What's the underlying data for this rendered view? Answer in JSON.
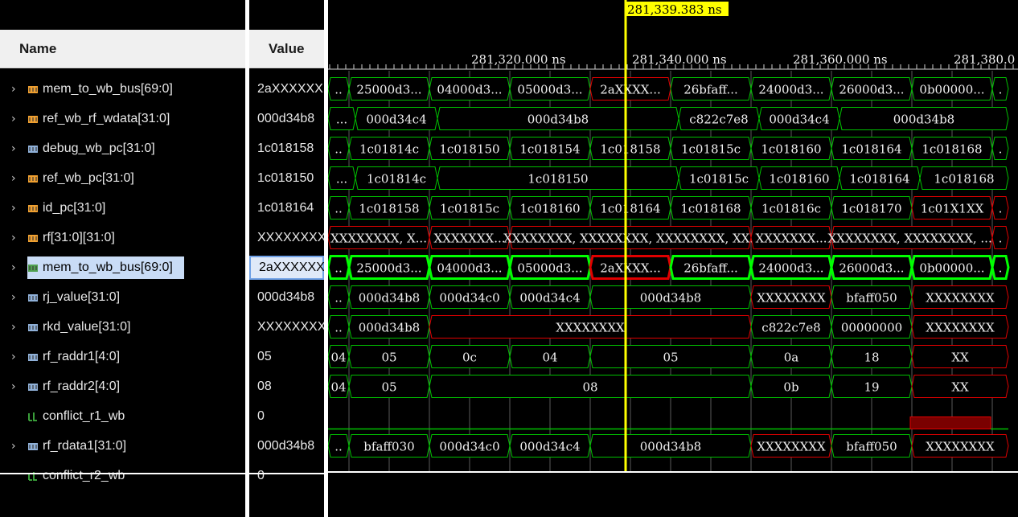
{
  "columns": {
    "name": "Name",
    "value": "Value"
  },
  "cursor": {
    "time_label": "281,339.383 ns",
    "color": "#ffff00"
  },
  "timeline": {
    "labels": [
      "281,320.000 ns",
      "281,340.000 ns",
      "281,360.000 ns",
      "281,380.0"
    ]
  },
  "colors": {
    "green": "#00c000",
    "red": "#e00000",
    "highlight_green": "#00ff00",
    "grid": "#5a5a5a",
    "selection": "#c9dcf6"
  },
  "signals": [
    {
      "name": "mem_to_wb_bus[69:0]",
      "value": "2aXXXXXX",
      "expandable": true,
      "icon": "bus-icon-orange",
      "selected": false,
      "segments": [
        {
          "text": "..",
          "state": "ok"
        },
        {
          "text": "25000d3...",
          "state": "ok"
        },
        {
          "text": "04000d3...",
          "state": "ok"
        },
        {
          "text": "05000d3...",
          "state": "ok"
        },
        {
          "text": "2aXXXX...",
          "state": "x"
        },
        {
          "text": "26bfaff...",
          "state": "ok"
        },
        {
          "text": "24000d3...",
          "state": "ok"
        },
        {
          "text": "26000d3...",
          "state": "ok"
        },
        {
          "text": "0b00000...",
          "state": "ok"
        },
        {
          "text": ".",
          "state": "ok"
        }
      ]
    },
    {
      "name": "ref_wb_rf_wdata[31:0]",
      "value": "000d34b8",
      "expandable": true,
      "icon": "bus-icon-orange",
      "selected": false,
      "segments": [
        {
          "text": "...",
          "state": "ok"
        },
        {
          "text": "000d34c4",
          "state": "ok"
        },
        {
          "text": "000d34b8",
          "state": "ok"
        },
        {
          "text": "c822c7e8",
          "state": "ok"
        },
        {
          "text": "000d34c4",
          "state": "ok"
        },
        {
          "text": "000d34b8",
          "state": "ok"
        }
      ]
    },
    {
      "name": "debug_wb_pc[31:0]",
      "value": "1c018158",
      "expandable": true,
      "icon": "bus-icon-blue",
      "selected": false,
      "segments": [
        {
          "text": "..",
          "state": "ok"
        },
        {
          "text": "1c01814c",
          "state": "ok"
        },
        {
          "text": "1c018150",
          "state": "ok"
        },
        {
          "text": "1c018154",
          "state": "ok"
        },
        {
          "text": "1c018158",
          "state": "ok"
        },
        {
          "text": "1c01815c",
          "state": "ok"
        },
        {
          "text": "1c018160",
          "state": "ok"
        },
        {
          "text": "1c018164",
          "state": "ok"
        },
        {
          "text": "1c018168",
          "state": "ok"
        },
        {
          "text": ".",
          "state": "ok"
        }
      ]
    },
    {
      "name": "ref_wb_pc[31:0]",
      "value": "1c018150",
      "expandable": true,
      "icon": "bus-icon-orange",
      "selected": false,
      "segments": [
        {
          "text": "...",
          "state": "ok"
        },
        {
          "text": "1c01814c",
          "state": "ok"
        },
        {
          "text": "1c018150",
          "state": "ok"
        },
        {
          "text": "1c01815c",
          "state": "ok"
        },
        {
          "text": "1c018160",
          "state": "ok"
        },
        {
          "text": "1c018164",
          "state": "ok"
        },
        {
          "text": "1c018168",
          "state": "ok"
        }
      ]
    },
    {
      "name": "id_pc[31:0]",
      "value": "1c018164",
      "expandable": true,
      "icon": "bus-icon-orange",
      "selected": false,
      "segments": [
        {
          "text": "..",
          "state": "ok"
        },
        {
          "text": "1c018158",
          "state": "ok"
        },
        {
          "text": "1c01815c",
          "state": "ok"
        },
        {
          "text": "1c018160",
          "state": "ok"
        },
        {
          "text": "1c018164",
          "state": "ok"
        },
        {
          "text": "1c018168",
          "state": "ok"
        },
        {
          "text": "1c01816c",
          "state": "ok"
        },
        {
          "text": "1c018170",
          "state": "ok"
        },
        {
          "text": "1c01X1XX",
          "state": "x"
        },
        {
          "text": ".",
          "state": "x"
        }
      ]
    },
    {
      "name": "rf[31:0][31:0]",
      "value": "XXXXXXXX",
      "expandable": true,
      "icon": "bus-icon-orange",
      "selected": false,
      "segments": [
        {
          "text": "XXXXXXXX, X...",
          "state": "x"
        },
        {
          "text": "XXXXXXX...",
          "state": "x"
        },
        {
          "text": "XXXXXXXX, XXXXXXXX, XXXXXXXX, XX..",
          "state": "x"
        },
        {
          "text": "XXXXXXX...",
          "state": "x"
        },
        {
          "text": "XXXXXXXX, XXXXXXXX, ....",
          "state": "x"
        },
        {
          "text": ".",
          "state": "x"
        }
      ]
    },
    {
      "name": "mem_to_wb_bus[69:0]",
      "value": "2aXXXXXX",
      "expandable": true,
      "icon": "bus-icon-green",
      "selected": true,
      "segments": [
        {
          "text": "..",
          "state": "ok"
        },
        {
          "text": "25000d3...",
          "state": "ok"
        },
        {
          "text": "04000d3...",
          "state": "ok"
        },
        {
          "text": "05000d3...",
          "state": "ok"
        },
        {
          "text": "2aXXXX...",
          "state": "x"
        },
        {
          "text": "26bfaff...",
          "state": "ok"
        },
        {
          "text": "24000d3...",
          "state": "ok"
        },
        {
          "text": "26000d3...",
          "state": "ok"
        },
        {
          "text": "0b00000...",
          "state": "ok"
        },
        {
          "text": ".",
          "state": "ok"
        }
      ]
    },
    {
      "name": "rj_value[31:0]",
      "value": "000d34b8",
      "expandable": true,
      "icon": "bus-icon-blue",
      "selected": false,
      "segments": [
        {
          "text": "..",
          "state": "ok"
        },
        {
          "text": "000d34b8",
          "state": "ok"
        },
        {
          "text": "000d34c0",
          "state": "ok"
        },
        {
          "text": "000d34c4",
          "state": "ok"
        },
        {
          "text": "000d34b8",
          "state": "ok"
        },
        {
          "text": "XXXXXXXX",
          "state": "x"
        },
        {
          "text": "bfaff050",
          "state": "ok"
        },
        {
          "text": "XXXXXXXX",
          "state": "x"
        }
      ]
    },
    {
      "name": "rkd_value[31:0]",
      "value": "XXXXXXXX",
      "expandable": true,
      "icon": "bus-icon-blue",
      "selected": false,
      "segments": [
        {
          "text": "..",
          "state": "ok"
        },
        {
          "text": "000d34b8",
          "state": "ok"
        },
        {
          "text": "XXXXXXXX",
          "state": "x"
        },
        {
          "text": "c822c7e8",
          "state": "ok"
        },
        {
          "text": "00000000",
          "state": "ok"
        },
        {
          "text": "XXXXXXXX",
          "state": "x"
        }
      ]
    },
    {
      "name": "rf_raddr1[4:0]",
      "value": "05",
      "expandable": true,
      "icon": "bus-icon-blue",
      "selected": false,
      "segments": [
        {
          "text": "04",
          "state": "ok"
        },
        {
          "text": "05",
          "state": "ok"
        },
        {
          "text": "0c",
          "state": "ok"
        },
        {
          "text": "04",
          "state": "ok"
        },
        {
          "text": "05",
          "state": "ok"
        },
        {
          "text": "0a",
          "state": "ok"
        },
        {
          "text": "18",
          "state": "ok"
        },
        {
          "text": "XX",
          "state": "x"
        }
      ]
    },
    {
      "name": "rf_raddr2[4:0]",
      "value": "08",
      "expandable": true,
      "icon": "bus-icon-blue",
      "selected": false,
      "segments": [
        {
          "text": "04",
          "state": "ok"
        },
        {
          "text": "05",
          "state": "ok"
        },
        {
          "text": "08",
          "state": "ok"
        },
        {
          "text": "0b",
          "state": "ok"
        },
        {
          "text": "19",
          "state": "ok"
        },
        {
          "text": "XX",
          "state": "x"
        }
      ]
    },
    {
      "name": "conflict_r1_wb",
      "value": "0",
      "expandable": false,
      "icon": "bit-icon-green",
      "selected": false,
      "segments": []
    },
    {
      "name": "rf_rdata1[31:0]",
      "value": "000d34b8",
      "expandable": true,
      "icon": "bus-icon-blue",
      "selected": false,
      "segments": [
        {
          "text": "..",
          "state": "ok"
        },
        {
          "text": "bfaff030",
          "state": "ok"
        },
        {
          "text": "000d34c0",
          "state": "ok"
        },
        {
          "text": "000d34c4",
          "state": "ok"
        },
        {
          "text": "000d34b8",
          "state": "ok"
        },
        {
          "text": "XXXXXXXX",
          "state": "x"
        },
        {
          "text": "bfaff050",
          "state": "ok"
        },
        {
          "text": "XXXXXXXX",
          "state": "x"
        }
      ]
    },
    {
      "name": "conflict_r2_wb",
      "value": "0",
      "expandable": false,
      "icon": "bit-icon-green",
      "selected": false,
      "segments": []
    }
  ]
}
